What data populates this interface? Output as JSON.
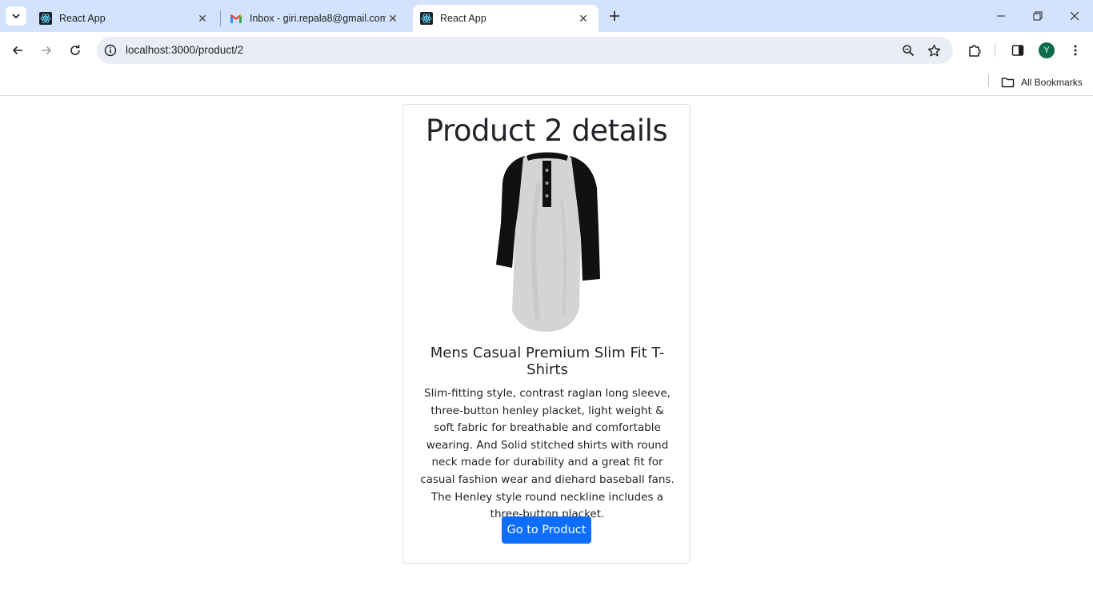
{
  "browser": {
    "tabs": [
      {
        "label": "React App",
        "icon": "react-icon",
        "active": false
      },
      {
        "label": "Inbox - giri.repala8@gmail.com",
        "icon": "gmail-icon",
        "active": false
      },
      {
        "label": "React App",
        "icon": "react-icon",
        "active": true
      }
    ],
    "url": "localhost:3000/product/2",
    "profile_initial": "Y",
    "bookmarks_label": "All Bookmarks"
  },
  "product": {
    "heading": "Product 2 details",
    "title": "Mens Casual Premium Slim Fit T-Shirts",
    "description": "Slim-fitting style, contrast raglan long sleeve, three-button henley placket, light weight & soft fabric for breathable and comfortable wearing. And Solid stitched shirts with round neck made for durability and a great fit for casual fashion wear and diehard baseball fans. The Henley style round neckline includes a three-button placket.",
    "button_label": "Go to Product"
  },
  "colors": {
    "tabstrip": "#d3e3fd",
    "omnibox": "#e9eef6",
    "primary_button": "#0d6efd",
    "avatar": "#0b6b4d"
  }
}
